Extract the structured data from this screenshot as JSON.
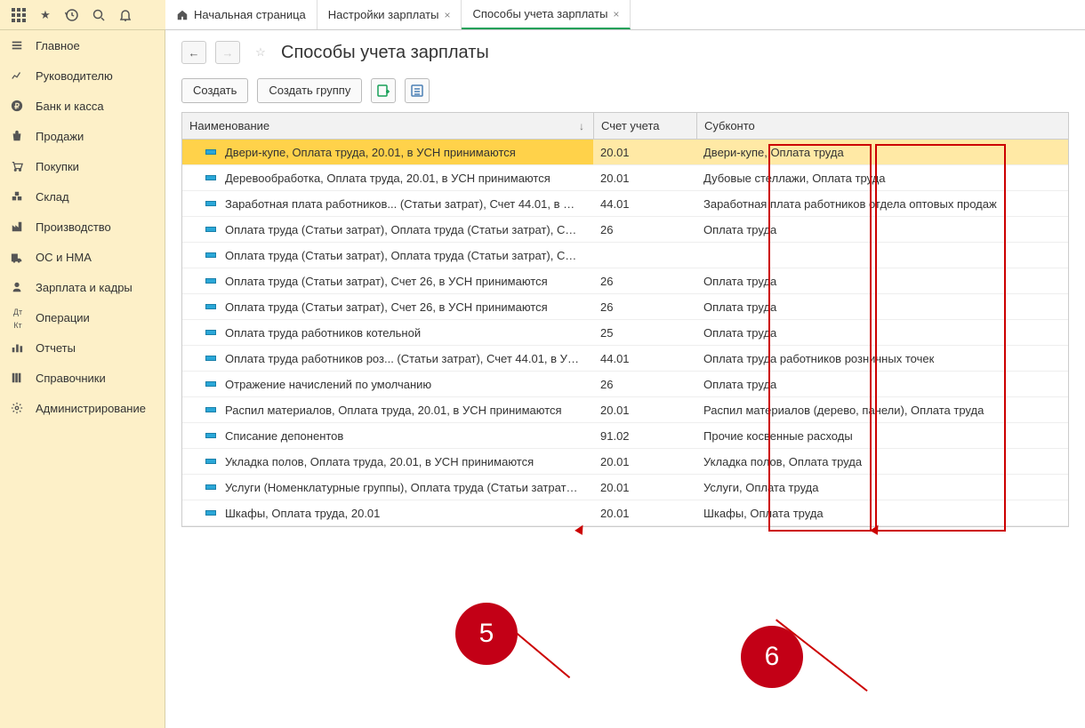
{
  "tabs": [
    {
      "label": "Начальная страница",
      "home": true,
      "close": false,
      "active": false
    },
    {
      "label": "Настройки зарплаты",
      "home": false,
      "close": true,
      "active": false
    },
    {
      "label": "Способы учета зарплаты",
      "home": false,
      "close": true,
      "active": true
    }
  ],
  "sidebar": [
    {
      "label": "Главное",
      "icon": "menu"
    },
    {
      "label": "Руководителю",
      "icon": "chart"
    },
    {
      "label": "Банк и касса",
      "icon": "ruble"
    },
    {
      "label": "Продажи",
      "icon": "bag"
    },
    {
      "label": "Покупки",
      "icon": "cart"
    },
    {
      "label": "Склад",
      "icon": "boxes"
    },
    {
      "label": "Производство",
      "icon": "factory"
    },
    {
      "label": "ОС и НМА",
      "icon": "truck"
    },
    {
      "label": "Зарплата и кадры",
      "icon": "person"
    },
    {
      "label": "Операции",
      "icon": "dtkt"
    },
    {
      "label": "Отчеты",
      "icon": "bars"
    },
    {
      "label": "Справочники",
      "icon": "books"
    },
    {
      "label": "Администрирование",
      "icon": "gear"
    }
  ],
  "page": {
    "title": "Способы учета зарплаты",
    "btn_create": "Создать",
    "btn_create_group": "Создать группу"
  },
  "columns": {
    "name": "Наименование",
    "account": "Счет учета",
    "subconto": "Субконто"
  },
  "rows": [
    {
      "name": "Двери-купе, Оплата труда, 20.01, в УСН принимаются",
      "account": "20.01",
      "sub": "Двери-купе, Оплата труда",
      "selected": true
    },
    {
      "name": "Деревообработка, Оплата труда, 20.01, в УСН принимаются",
      "account": "20.01",
      "sub": "Дубовые стеллажи, Оплата труда"
    },
    {
      "name": "Заработная плата работников... (Статьи затрат), Счет 44.01, в УС...",
      "account": "44.01",
      "sub": "Заработная плата работников отдела оптовых продаж"
    },
    {
      "name": "Оплата труда (Статьи затрат), Оплата труда (Статьи затрат), Счет...",
      "account": "26",
      "sub": "Оплата труда"
    },
    {
      "name": "Оплата труда (Статьи затрат), Оплата труда (Статьи затрат), Счет...",
      "account": "",
      "sub": ""
    },
    {
      "name": "Оплата труда (Статьи затрат), Счет 26, в УСН принимаются",
      "account": "26",
      "sub": "Оплата труда"
    },
    {
      "name": "Оплата труда (Статьи затрат), Счет 26, в УСН принимаются",
      "account": "26",
      "sub": "Оплата труда"
    },
    {
      "name": "Оплата труда работников котельной",
      "account": "25",
      "sub": "Оплата труда"
    },
    {
      "name": "Оплата труда работников роз... (Статьи затрат), Счет 44.01, в УС...",
      "account": "44.01",
      "sub": "Оплата труда работников розничных точек"
    },
    {
      "name": "Отражение начислений по умолчанию",
      "account": "26",
      "sub": "Оплата труда"
    },
    {
      "name": "Распил материалов, Оплата труда, 20.01, в УСН принимаются",
      "account": "20.01",
      "sub": "Распил материалов (дерево, панели), Оплата труда"
    },
    {
      "name": "Списание депонентов",
      "account": "91.02",
      "sub": "Прочие косвенные расходы"
    },
    {
      "name": "Укладка полов, Оплата труда, 20.01, в УСН принимаются",
      "account": "20.01",
      "sub": "Укладка полов, Оплата труда"
    },
    {
      "name": "Услуги (Номенклатурные группы), Оплата труда (Статьи затрат), ...",
      "account": "20.01",
      "sub": "Услуги, Оплата труда"
    },
    {
      "name": "Шкафы, Оплата труда, 20.01",
      "account": "20.01",
      "sub": "Шкафы, Оплата труда"
    }
  ],
  "annotations": {
    "circle5": "5",
    "circle6": "6"
  }
}
